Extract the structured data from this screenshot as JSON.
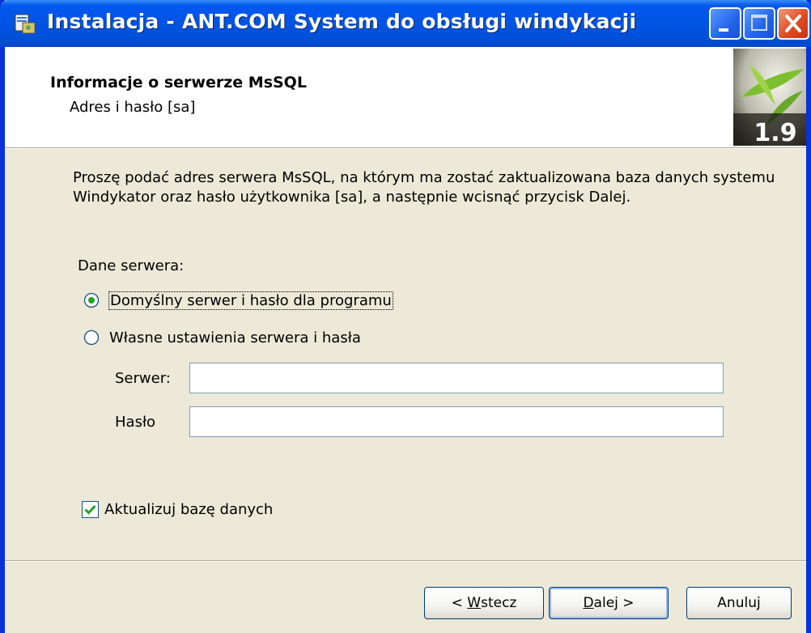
{
  "window": {
    "title": "Instalacja - ANT.COM System do obsługi windykacji"
  },
  "header": {
    "title": "Informacje o serwerze MsSQL",
    "subtitle": "Adres i hasło [sa]",
    "logo_version": "1.9"
  },
  "body": {
    "description": "Proszę podać adres serwera MsSQL, na którym ma zostać zaktualizowana baza danych systemu Windykator oraz hasło użytkownika [sa], a następnie wcisnąć przycisk Dalej.",
    "server_section_label": "Dane serwera:",
    "radio_default": {
      "label": "Domyślny serwer i hasło dla programu",
      "selected": true
    },
    "radio_custom": {
      "label": "Własne ustawienia serwera i hasła",
      "selected": false
    },
    "server_label": "Serwer:",
    "server_value": "",
    "password_label": "Hasło",
    "password_value": "",
    "update_db": {
      "label": "Aktualizuj bazę danych",
      "checked": true
    }
  },
  "buttons": {
    "back_prefix": "< ",
    "back_hotkey": "W",
    "back_rest": "stecz",
    "next_hotkey": "D",
    "next_rest": "alej >",
    "cancel": "Anuluj"
  },
  "colors": {
    "titlebar": "#0054e3",
    "window_bg": "#ece9d8",
    "close_button": "#e04a22"
  }
}
